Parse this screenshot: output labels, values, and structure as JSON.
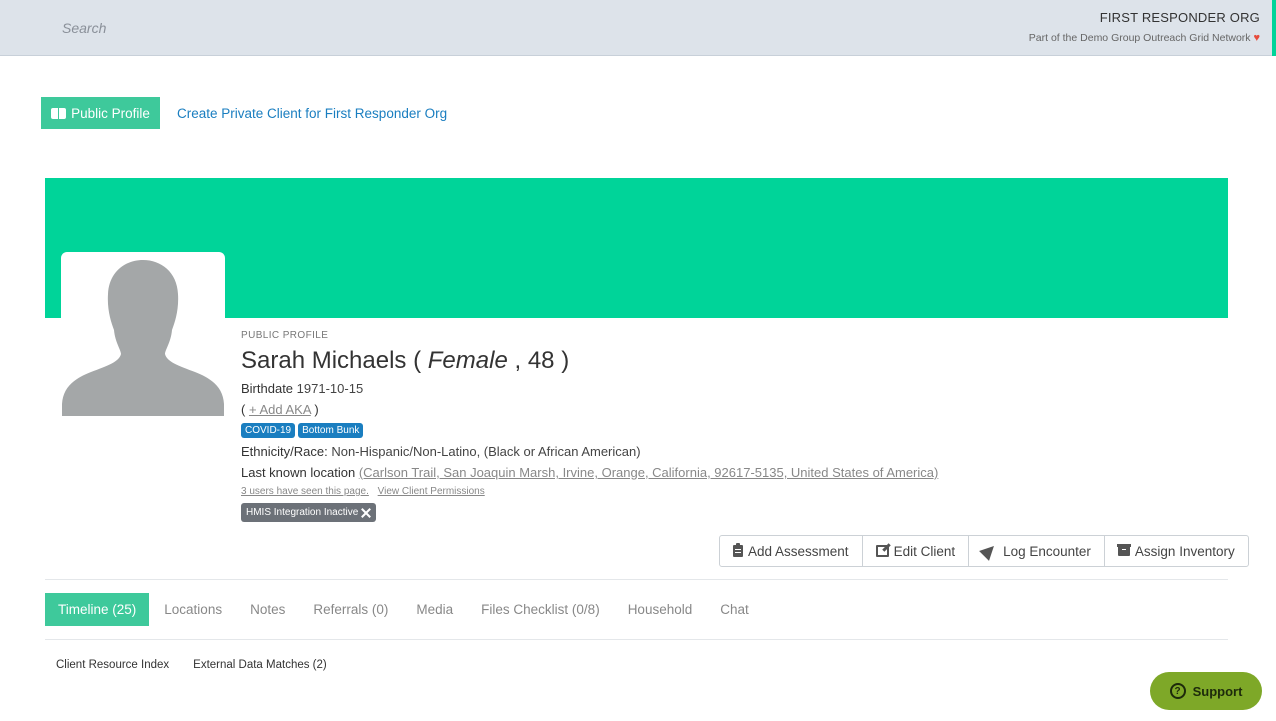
{
  "header": {
    "search_placeholder": "Search",
    "org_name": "FIRST RESPONDER ORG",
    "org_subtitle": "Part of the Demo Group Outreach Grid Network",
    "heart_icon": "♥",
    "accent_color": "#00d499"
  },
  "actions": {
    "public_profile_label": "Public Profile",
    "create_private_label": "Create Private Client for First Responder Org"
  },
  "profile": {
    "section_label": "PUBLIC PROFILE",
    "name": "Sarah Michaels",
    "open_paren": "(",
    "gender": "Female",
    "age_sep": ",",
    "age": "48",
    "close_paren": ")",
    "birthdate_label": "Birthdate",
    "birthdate": "1971-10-15",
    "aka_open": "(",
    "aka_link": "+ Add AKA",
    "aka_close": ")",
    "tags": [
      "COVID-19",
      "Bottom Bunk"
    ],
    "ethnicity_label": "Ethnicity/Race:",
    "ethnicity_value": "Non-Hispanic/Non-Latino, (Black or African American)",
    "location_label": "Last known location",
    "location_value": "(Carlson Trail, San Joaquin Marsh, Irvine, Orange, California, 92617-5135, United States of America)",
    "seen_link": "3 users have seen this page.",
    "permissions_link": "View Client Permissions",
    "hmis_badge": "HMIS Integration Inactive"
  },
  "toolbar": {
    "add_assessment": "Add Assessment",
    "edit_client": "Edit Client",
    "log_encounter": "Log Encounter",
    "assign_inventory": "Assign Inventory"
  },
  "tabs": [
    {
      "label": "Timeline (25)",
      "active": true
    },
    {
      "label": "Locations",
      "active": false
    },
    {
      "label": "Notes",
      "active": false
    },
    {
      "label": "Referrals (0)",
      "active": false
    },
    {
      "label": "Media",
      "active": false
    },
    {
      "label": "Files Checklist (0/8)",
      "active": false
    },
    {
      "label": "Household",
      "active": false
    },
    {
      "label": "Chat",
      "active": false
    }
  ],
  "subtabs": [
    "Client Resource Index",
    "External Data Matches (2)"
  ],
  "support": {
    "label": "Support",
    "icon": "?",
    "color": "#7ea828"
  }
}
